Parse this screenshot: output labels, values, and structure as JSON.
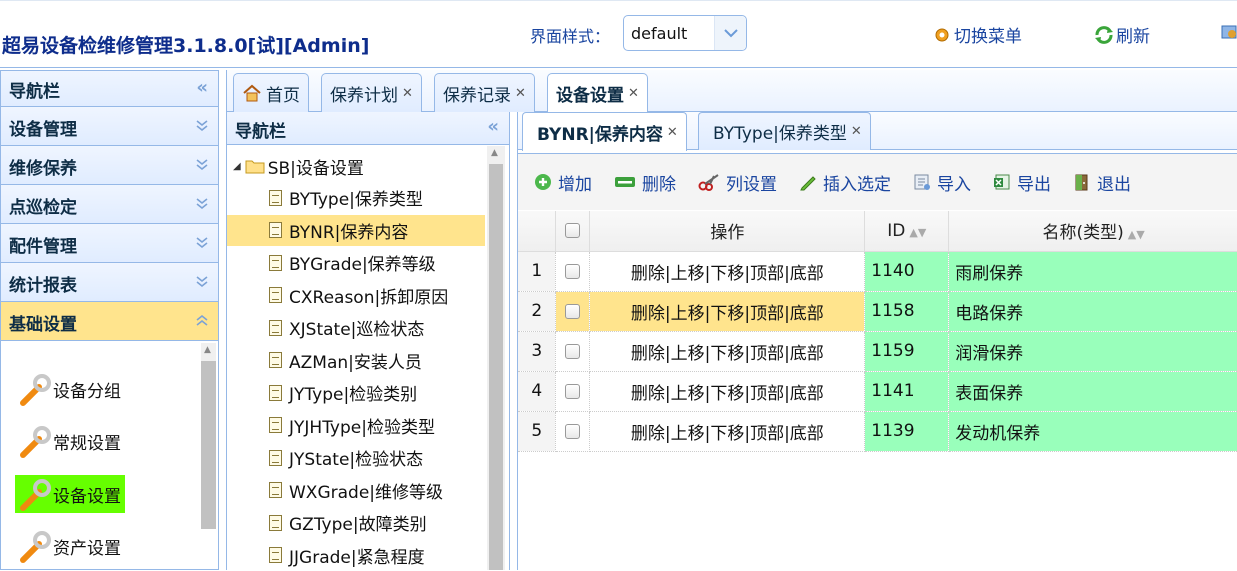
{
  "header": {
    "app_title": "超易设备检维修管理3.1.8.0[试][Admin]",
    "theme_label": "界面样式：",
    "theme_value": "default",
    "switch_menu": "切换菜单",
    "refresh": "刷新"
  },
  "leftnav": {
    "title": "导航栏",
    "sections": [
      "设备管理",
      "维修保养",
      "点巡检定",
      "配件管理",
      "统计报表",
      "基础设置"
    ],
    "active_section": "基础设置",
    "tools": [
      "设备分组",
      "常规设置",
      "设备设置",
      "资产设置"
    ],
    "selected_tool": "设备设置"
  },
  "tabs": [
    "首页",
    "保养计划",
    "保养记录",
    "设备设置"
  ],
  "active_tab": "设备设置",
  "tree": {
    "title": "导航栏",
    "root": "SB|设备设置",
    "nodes": [
      "BYType|保养类型",
      "BYNR|保养内容",
      "BYGrade|保养等级",
      "CXReason|拆卸原因",
      "XJState|巡检状态",
      "AZMan|安装人员",
      "JYType|检验类别",
      "JYJHType|检验类型",
      "JYState|检验状态",
      "WXGrade|维修等级",
      "GZType|故障类别",
      "JJGrade|紧急程度"
    ],
    "selected": "BYNR|保养内容"
  },
  "subtabs": [
    "BYNR|保养内容",
    "BYType|保养类型"
  ],
  "toolbar": {
    "add": "增加",
    "delete": "删除",
    "columns": "列设置",
    "insert": "插入选定",
    "import": "导入",
    "export": "导出",
    "exit": "退出"
  },
  "grid": {
    "columns": [
      "操作",
      "ID",
      "名称(类型)"
    ],
    "rows": [
      {
        "num": "1",
        "ops": "删除|上移|下移|顶部|底部",
        "id": "1140",
        "name": "雨刷保养"
      },
      {
        "num": "2",
        "ops": "删除|上移|下移|顶部|底部",
        "id": "1158",
        "name": "电路保养"
      },
      {
        "num": "3",
        "ops": "删除|上移|下移|顶部|底部",
        "id": "1159",
        "name": "润滑保养"
      },
      {
        "num": "4",
        "ops": "删除|上移|下移|顶部|底部",
        "id": "1141",
        "name": "表面保养"
      },
      {
        "num": "5",
        "ops": "删除|上移|下移|顶部|底部",
        "id": "1139",
        "name": "发动机保养"
      }
    ],
    "selected_row": 2
  },
  "colors": {
    "border": "#95b8e7",
    "highlight": "#ffe48d",
    "id_bg": "#99ffbb",
    "selected_tool_bg": "#66ff00"
  }
}
